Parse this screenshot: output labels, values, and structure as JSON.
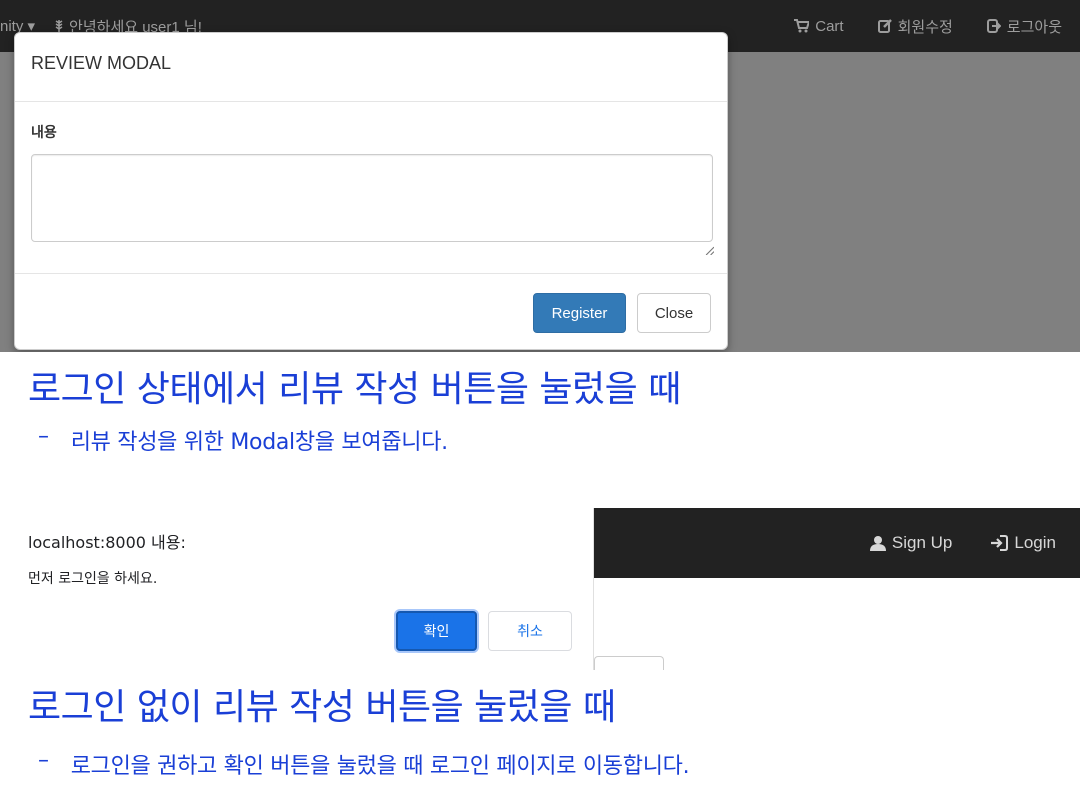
{
  "screenshot1": {
    "navbar": {
      "left_partial_label": "nity ▾",
      "greeting": "안녕하세요 user1 님!",
      "cart_label": "Cart",
      "edit_member_label": "회원수정",
      "logout_label": "로그아웃"
    },
    "modal": {
      "title": "REVIEW MODAL",
      "content_label": "내용",
      "content_value": "",
      "register_button": "Register",
      "close_button": "Close"
    }
  },
  "caption1": {
    "title": "로그인 상태에서 리뷰 작성 버튼을 눌렀을 때",
    "bullet": "–",
    "text": "리뷰 작성을 위한 Modal창을 보여줍니다."
  },
  "screenshot2": {
    "navbar": {
      "signup_label": "Sign Up",
      "login_label": "Login"
    },
    "dialog": {
      "origin": "localhost:8000 내용:",
      "message": "먼저 로그인을 하세요.",
      "ok_button": "확인",
      "cancel_button": "취소"
    }
  },
  "caption2": {
    "title": "로그인 없이 리뷰 작성 버튼을 눌렀을 때",
    "bullet": "–",
    "text": "로그인을 권하고 확인 버튼을 눌렀을 때 로그인 페이지로 이동합니다."
  },
  "colors": {
    "caption": "#1a3fd6",
    "navbar": "#222222",
    "backdrop": "#808080",
    "primary_button": "#337ab7",
    "dialog_ok": "#1a73e8"
  }
}
